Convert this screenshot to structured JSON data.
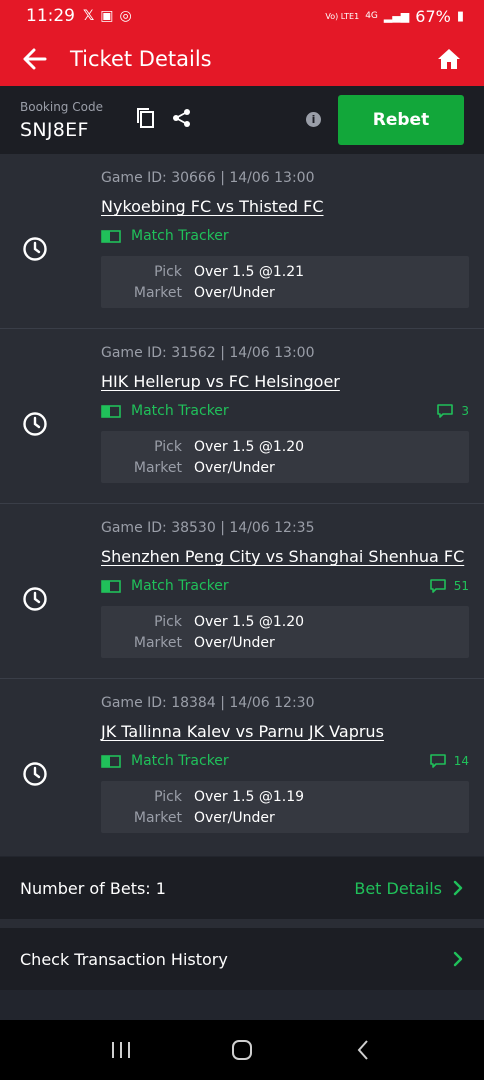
{
  "status_bar": {
    "time": "11:29",
    "network": "Vo) LTE1",
    "signal": "4G",
    "battery": "67%"
  },
  "header": {
    "title": "Ticket Details"
  },
  "booking": {
    "label": "Booking Code",
    "code": "SNJ8EF",
    "info": "i",
    "rebet_label": "Rebet"
  },
  "bets": [
    {
      "game_id": "Game ID: 30666 | 14/06 13:00",
      "match": "Nykoebing FC vs Thisted FC",
      "tracker": "Match Tracker",
      "comments": "",
      "pick_label": "Pick",
      "pick": "Over 1.5 @1.21",
      "market_label": "Market",
      "market": "Over/Under"
    },
    {
      "game_id": "Game ID: 31562 | 14/06 13:00",
      "match": "HIK Hellerup vs FC Helsingoer",
      "tracker": "Match Tracker",
      "comments": "3",
      "pick_label": "Pick",
      "pick": "Over 1.5 @1.20",
      "market_label": "Market",
      "market": "Over/Under"
    },
    {
      "game_id": "Game ID: 38530 | 14/06 12:35",
      "match": "Shenzhen Peng City vs Shanghai Shenhua FC",
      "tracker": "Match Tracker",
      "comments": "51",
      "pick_label": "Pick",
      "pick": "Over 1.5 @1.20",
      "market_label": "Market",
      "market": "Over/Under"
    },
    {
      "game_id": "Game ID: 18384 | 14/06 12:30",
      "match": "JK Tallinna Kalev vs Parnu JK Vaprus",
      "tracker": "Match Tracker",
      "comments": "14",
      "pick_label": "Pick",
      "pick": "Over 1.5 @1.19",
      "market_label": "Market",
      "market": "Over/Under"
    }
  ],
  "summary": {
    "bets_count": "Number of Bets: 1",
    "bet_details": "Bet Details",
    "history": "Check Transaction History"
  },
  "colors": {
    "brand_red": "#e41827",
    "accent_green": "#20c05a",
    "button_green": "#12a73a",
    "background": "#22252d"
  },
  "icons": [
    "back-arrow-icon",
    "home-icon",
    "copy-icon",
    "share-icon",
    "info-icon",
    "clock-icon",
    "match-tracker-icon",
    "comment-icon",
    "chevron-right-icon"
  ]
}
